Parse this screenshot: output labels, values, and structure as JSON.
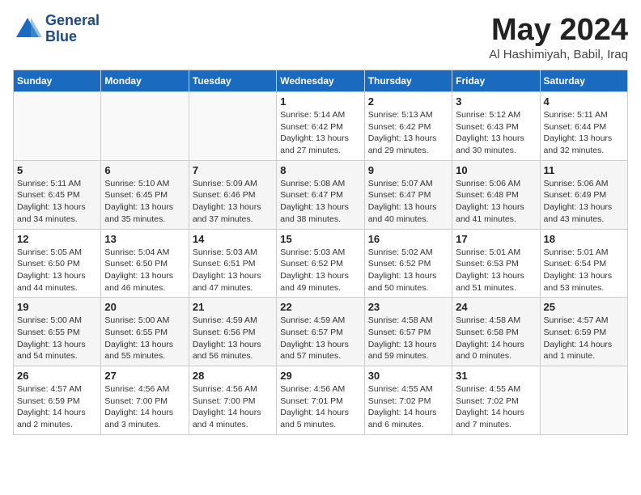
{
  "header": {
    "logo_line1": "General",
    "logo_line2": "Blue",
    "month": "May 2024",
    "location": "Al Hashimiyah, Babil, Iraq"
  },
  "weekdays": [
    "Sunday",
    "Monday",
    "Tuesday",
    "Wednesday",
    "Thursday",
    "Friday",
    "Saturday"
  ],
  "weeks": [
    [
      {
        "day": "",
        "info": ""
      },
      {
        "day": "",
        "info": ""
      },
      {
        "day": "",
        "info": ""
      },
      {
        "day": "1",
        "info": "Sunrise: 5:14 AM\nSunset: 6:42 PM\nDaylight: 13 hours\nand 27 minutes."
      },
      {
        "day": "2",
        "info": "Sunrise: 5:13 AM\nSunset: 6:42 PM\nDaylight: 13 hours\nand 29 minutes."
      },
      {
        "day": "3",
        "info": "Sunrise: 5:12 AM\nSunset: 6:43 PM\nDaylight: 13 hours\nand 30 minutes."
      },
      {
        "day": "4",
        "info": "Sunrise: 5:11 AM\nSunset: 6:44 PM\nDaylight: 13 hours\nand 32 minutes."
      }
    ],
    [
      {
        "day": "5",
        "info": "Sunrise: 5:11 AM\nSunset: 6:45 PM\nDaylight: 13 hours\nand 34 minutes."
      },
      {
        "day": "6",
        "info": "Sunrise: 5:10 AM\nSunset: 6:45 PM\nDaylight: 13 hours\nand 35 minutes."
      },
      {
        "day": "7",
        "info": "Sunrise: 5:09 AM\nSunset: 6:46 PM\nDaylight: 13 hours\nand 37 minutes."
      },
      {
        "day": "8",
        "info": "Sunrise: 5:08 AM\nSunset: 6:47 PM\nDaylight: 13 hours\nand 38 minutes."
      },
      {
        "day": "9",
        "info": "Sunrise: 5:07 AM\nSunset: 6:47 PM\nDaylight: 13 hours\nand 40 minutes."
      },
      {
        "day": "10",
        "info": "Sunrise: 5:06 AM\nSunset: 6:48 PM\nDaylight: 13 hours\nand 41 minutes."
      },
      {
        "day": "11",
        "info": "Sunrise: 5:06 AM\nSunset: 6:49 PM\nDaylight: 13 hours\nand 43 minutes."
      }
    ],
    [
      {
        "day": "12",
        "info": "Sunrise: 5:05 AM\nSunset: 6:50 PM\nDaylight: 13 hours\nand 44 minutes."
      },
      {
        "day": "13",
        "info": "Sunrise: 5:04 AM\nSunset: 6:50 PM\nDaylight: 13 hours\nand 46 minutes."
      },
      {
        "day": "14",
        "info": "Sunrise: 5:03 AM\nSunset: 6:51 PM\nDaylight: 13 hours\nand 47 minutes."
      },
      {
        "day": "15",
        "info": "Sunrise: 5:03 AM\nSunset: 6:52 PM\nDaylight: 13 hours\nand 49 minutes."
      },
      {
        "day": "16",
        "info": "Sunrise: 5:02 AM\nSunset: 6:52 PM\nDaylight: 13 hours\nand 50 minutes."
      },
      {
        "day": "17",
        "info": "Sunrise: 5:01 AM\nSunset: 6:53 PM\nDaylight: 13 hours\nand 51 minutes."
      },
      {
        "day": "18",
        "info": "Sunrise: 5:01 AM\nSunset: 6:54 PM\nDaylight: 13 hours\nand 53 minutes."
      }
    ],
    [
      {
        "day": "19",
        "info": "Sunrise: 5:00 AM\nSunset: 6:55 PM\nDaylight: 13 hours\nand 54 minutes."
      },
      {
        "day": "20",
        "info": "Sunrise: 5:00 AM\nSunset: 6:55 PM\nDaylight: 13 hours\nand 55 minutes."
      },
      {
        "day": "21",
        "info": "Sunrise: 4:59 AM\nSunset: 6:56 PM\nDaylight: 13 hours\nand 56 minutes."
      },
      {
        "day": "22",
        "info": "Sunrise: 4:59 AM\nSunset: 6:57 PM\nDaylight: 13 hours\nand 57 minutes."
      },
      {
        "day": "23",
        "info": "Sunrise: 4:58 AM\nSunset: 6:57 PM\nDaylight: 13 hours\nand 59 minutes."
      },
      {
        "day": "24",
        "info": "Sunrise: 4:58 AM\nSunset: 6:58 PM\nDaylight: 14 hours\nand 0 minutes."
      },
      {
        "day": "25",
        "info": "Sunrise: 4:57 AM\nSunset: 6:59 PM\nDaylight: 14 hours\nand 1 minute."
      }
    ],
    [
      {
        "day": "26",
        "info": "Sunrise: 4:57 AM\nSunset: 6:59 PM\nDaylight: 14 hours\nand 2 minutes."
      },
      {
        "day": "27",
        "info": "Sunrise: 4:56 AM\nSunset: 7:00 PM\nDaylight: 14 hours\nand 3 minutes."
      },
      {
        "day": "28",
        "info": "Sunrise: 4:56 AM\nSunset: 7:00 PM\nDaylight: 14 hours\nand 4 minutes."
      },
      {
        "day": "29",
        "info": "Sunrise: 4:56 AM\nSunset: 7:01 PM\nDaylight: 14 hours\nand 5 minutes."
      },
      {
        "day": "30",
        "info": "Sunrise: 4:55 AM\nSunset: 7:02 PM\nDaylight: 14 hours\nand 6 minutes."
      },
      {
        "day": "31",
        "info": "Sunrise: 4:55 AM\nSunset: 7:02 PM\nDaylight: 14 hours\nand 7 minutes."
      },
      {
        "day": "",
        "info": ""
      }
    ]
  ]
}
